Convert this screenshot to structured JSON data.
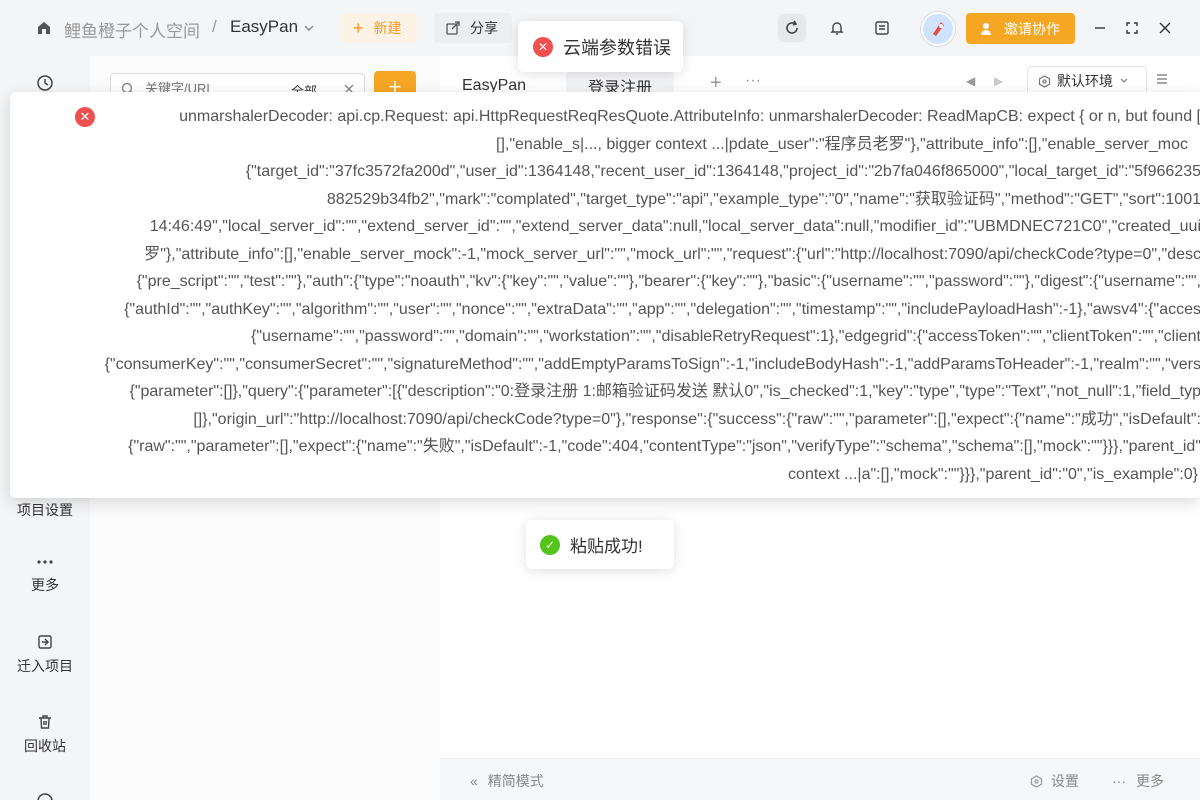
{
  "titlebar": {
    "space_name": "鲤鱼橙子个人空间",
    "separator": "/",
    "project_name": "EasyPan",
    "new_label": "新建",
    "share_label": "分享",
    "invite_label": "邀请协作"
  },
  "rail": {
    "project_settings": "项目设置",
    "more": "更多",
    "import_project": "迁入项目",
    "trash": "回收站"
  },
  "panel": {
    "search_placeholder": "关键字/URL",
    "search_scope": "全部"
  },
  "tabs": [
    {
      "label": "EasyPan"
    },
    {
      "label": "登录注册"
    }
  ],
  "env": {
    "selected": "默认环境"
  },
  "bottom": {
    "simple_mode": "精简模式",
    "settings": "设置",
    "more": "更多"
  },
  "toast_error": {
    "message": "云端参数错误"
  },
  "toast_success": {
    "message": "粘贴成功!"
  },
  "error_popup": {
    "lines": [
      "unmarshalerDecoder: api.cp.Request: api.HttpRequestReqResQuote.AttributeInfo: unmarshalerDecoder: ReadMapCB: expect { or n, but found [",
      "[],\"enable_s|..., bigger context ...|pdate_user\":\"程序员老罗\"},\"attribute_info\":[],\"enable_server_moc",
      "{\"target_id\":\"37fc3572fa200d\",\"user_id\":1364148,\"recent_user_id\":1364148,\"project_id\":\"2b7fa046f865000\",\"local_target_id\":\"5f966235",
      "882529b34fb2\",\"mark\":\"complated\",\"target_type\":\"api\",\"example_type\":\"0\",\"name\":\"获取验证码\",\"method\":\"GET\",\"sort\":1001",
      "14:46:49\",\"local_server_id\":\"\",\"extend_server_id\":\"\",\"extend_server_data\":null,\"local_server_data\":null,\"modifier_id\":\"UBMDNEC721C0\",\"created_uui",
      "罗\"},\"attribute_info\":[],\"enable_server_mock\":-1,\"mock_server_url\":\"\",\"mock_url\":\"\",\"request\":{\"url\":\"http://localhost:7090/api/checkCode?type=0\",\"desc",
      "{\"pre_script\":\"\",\"test\":\"\"},\"auth\":{\"type\":\"noauth\",\"kv\":{\"key\":\"\",\"value\":\"\"},\"bearer\":{\"key\":\"\"},\"basic\":{\"username\":\"\",\"password\":\"\"},\"digest\":{\"username\":\"\",",
      "{\"authId\":\"\",\"authKey\":\"\",\"algorithm\":\"\",\"user\":\"\",\"nonce\":\"\",\"extraData\":\"\",\"app\":\"\",\"delegation\":\"\",\"timestamp\":\"\",\"includePayloadHash\":-1},\"awsv4\":{\"acces",
      "{\"username\":\"\",\"password\":\"\",\"domain\":\"\",\"workstation\":\"\",\"disableRetryRequest\":1},\"edgegrid\":{\"accessToken\":\"\",\"clientToken\":\"\",\"client",
      "{\"consumerKey\":\"\",\"consumerSecret\":\"\",\"signatureMethod\":\"\",\"addEmptyParamsToSign\":-1,\"includeBodyHash\":-1,\"addParamsToHeader\":-1,\"realm\":\"\",\"vers",
      "{\"parameter\":[]},\"query\":{\"parameter\":[{\"description\":\"0:登录注册 1:邮箱验证码发送 默认0\",\"is_checked\":1,\"key\":\"type\",\"type\":\"Text\",\"not_null\":1,\"field_typ",
      "[]},\"origin_url\":\"http://localhost:7090/api/checkCode?type=0\"},\"response\":{\"success\":{\"raw\":\"\",\"parameter\":[],\"expect\":{\"name\":\"成功\",\"isDefault\":",
      "{\"raw\":\"\",\"parameter\":[],\"expect\":{\"name\":\"失败\",\"isDefault\":-1,\"code\":404,\"contentType\":\"json\",\"verifyType\":\"schema\",\"schema\":[],\"mock\":\"\"}}},\"parent_id\"",
      "context ...|a\":[],\"mock\":\"\"}}},\"parent_id\":\"0\",\"is_example\":0}"
    ]
  },
  "colors": {
    "accent": "#f5a623",
    "error": "#f05050",
    "success": "#52c41a"
  }
}
